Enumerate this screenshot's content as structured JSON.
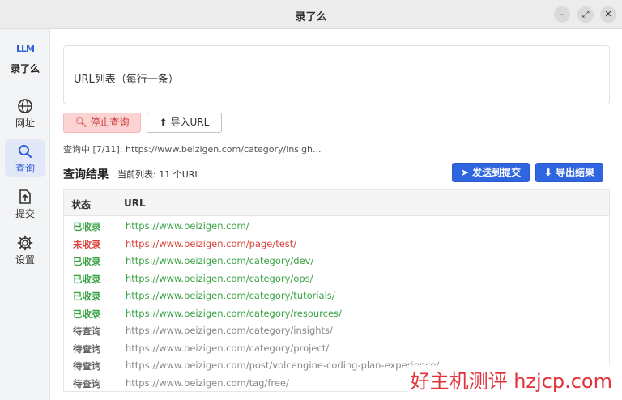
{
  "window": {
    "title": "录了么",
    "minimize": "–",
    "maximize": "⤢",
    "close": "✕"
  },
  "sidebar": {
    "logo": "LLM",
    "app_name": "录了么",
    "items": [
      {
        "label": "网址",
        "icon": "globe-icon"
      },
      {
        "label": "查询",
        "icon": "search-icon",
        "active": true
      },
      {
        "label": "提交",
        "icon": "upload-icon"
      },
      {
        "label": "设置",
        "icon": "gear-icon"
      }
    ]
  },
  "main": {
    "url_input": {
      "placeholder": "URL列表（每行一条）"
    },
    "stop_button": "停止查询",
    "import_button": "导入URL",
    "status": "查询中 [7/11]: https://www.beizigen.com/category/insigh...",
    "results_title": "查询结果",
    "current_list": "当前列表: 11 个URL",
    "send_button": "发送到提交",
    "export_button": "导出结果",
    "table": {
      "headers": [
        "状态",
        "URL"
      ],
      "rows": [
        {
          "status": "已收录",
          "url": "https://www.beizigen.com/",
          "type": "ok"
        },
        {
          "status": "未收录",
          "url": "https://www.beizigen.com/page/test/",
          "type": "no"
        },
        {
          "status": "已收录",
          "url": "https://www.beizigen.com/category/dev/",
          "type": "ok"
        },
        {
          "status": "已收录",
          "url": "https://www.beizigen.com/category/ops/",
          "type": "ok"
        },
        {
          "status": "已收录",
          "url": "https://www.beizigen.com/category/tutorials/",
          "type": "ok"
        },
        {
          "status": "已收录",
          "url": "https://www.beizigen.com/category/resources/",
          "type": "ok"
        },
        {
          "status": "待查询",
          "url": "https://www.beizigen.com/category/insights/",
          "type": "pend"
        },
        {
          "status": "待查询",
          "url": "https://www.beizigen.com/category/project/",
          "type": "pend"
        },
        {
          "status": "待查询",
          "url": "https://www.beizigen.com/post/volcengine-coding-plan-experience/",
          "type": "pend"
        },
        {
          "status": "待查询",
          "url": "https://www.beizigen.com/tag/free/",
          "type": "pend"
        }
      ]
    }
  },
  "watermark": "好主机测评 hzjcp.com",
  "colors": {
    "accent": "#2f66e0",
    "ok": "#3aa344",
    "no": "#d9433b",
    "pending": "#888888"
  }
}
